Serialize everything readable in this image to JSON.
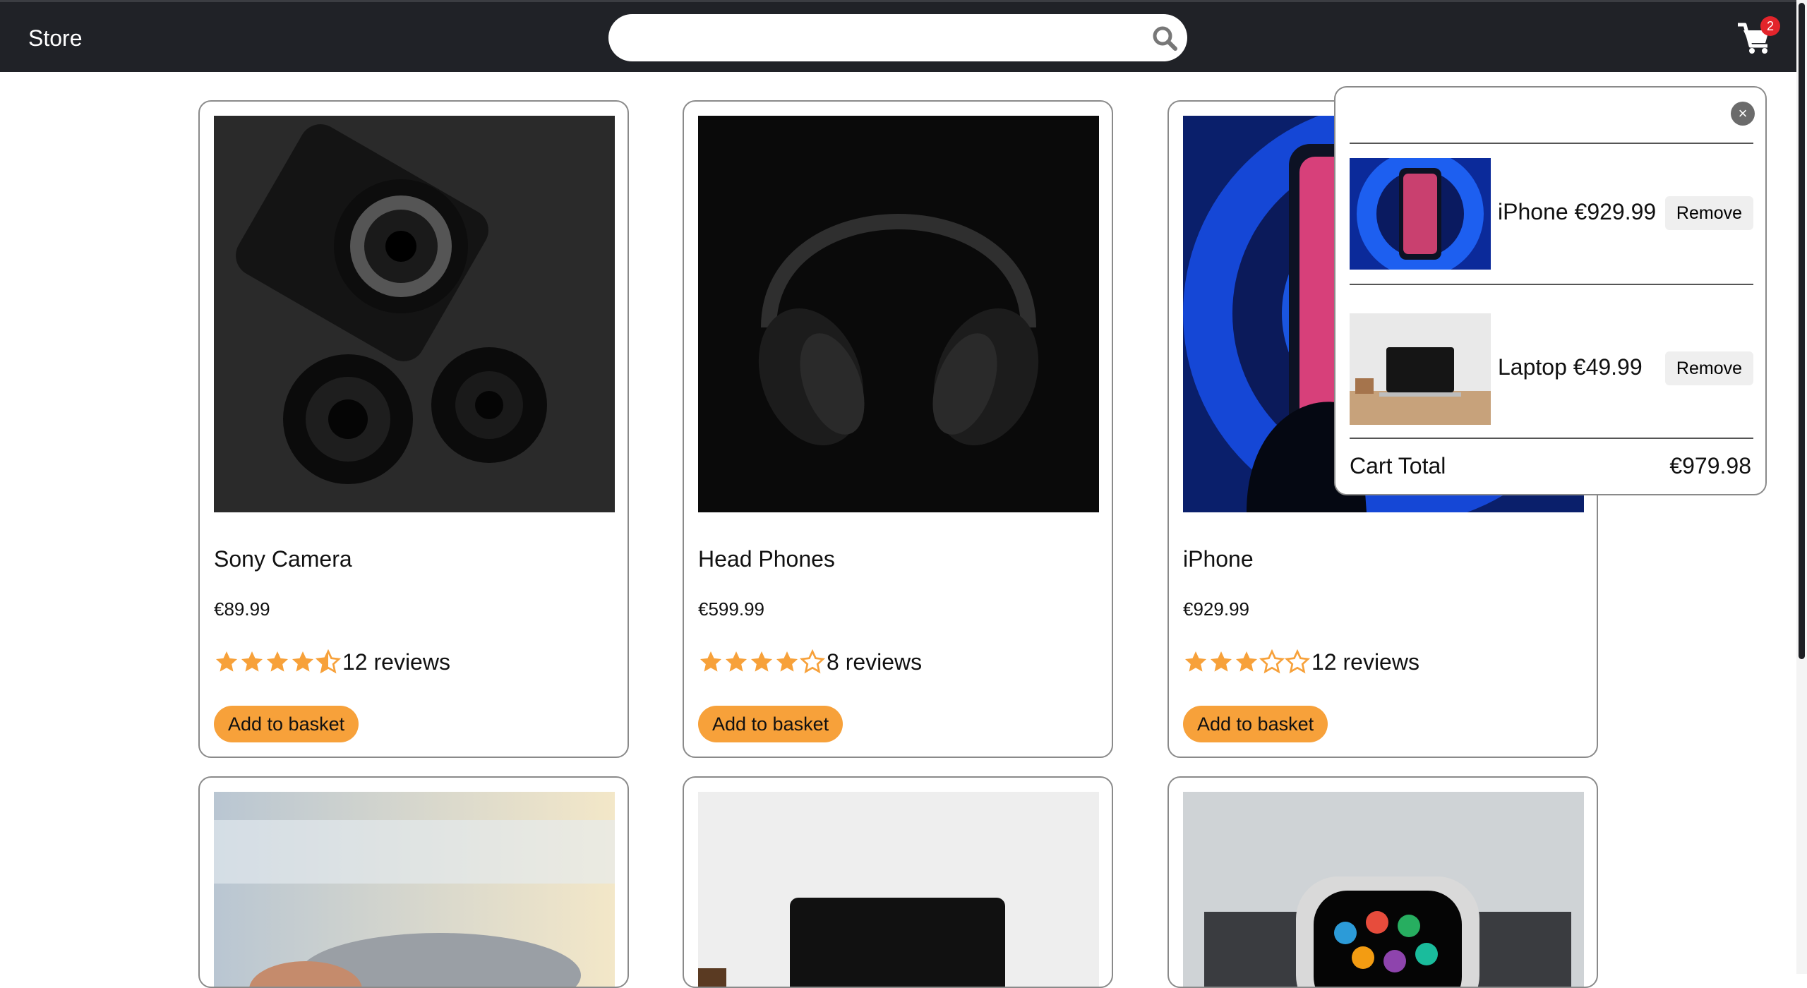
{
  "header": {
    "brand": "Store",
    "search_placeholder": "",
    "search_icon": "search-icon",
    "cart_icon": "shopping-cart-icon",
    "cart_count": "2"
  },
  "products": [
    {
      "name": "Sony Camera",
      "price": "€89.99",
      "rating": 4.5,
      "reviews": "12 reviews",
      "button": "Add to basket"
    },
    {
      "name": "Head Phones",
      "price": "€599.99",
      "rating": 4,
      "reviews": "8 reviews",
      "button": "Add to basket"
    },
    {
      "name": "iPhone",
      "price": "€929.99",
      "rating": 3,
      "reviews": "12 reviews",
      "button": "Add to basket"
    }
  ],
  "cart": {
    "close_icon": "close-icon",
    "items": [
      {
        "label": "iPhone €929.99",
        "remove": "Remove"
      },
      {
        "label": "Laptop €49.99",
        "remove": "Remove"
      }
    ],
    "total_label": "Cart Total",
    "total_value": "€979.98"
  },
  "colors": {
    "header_bg": "#202227",
    "accent": "#f7a13a",
    "star": "#f7a13a",
    "badge": "#e3242b"
  }
}
